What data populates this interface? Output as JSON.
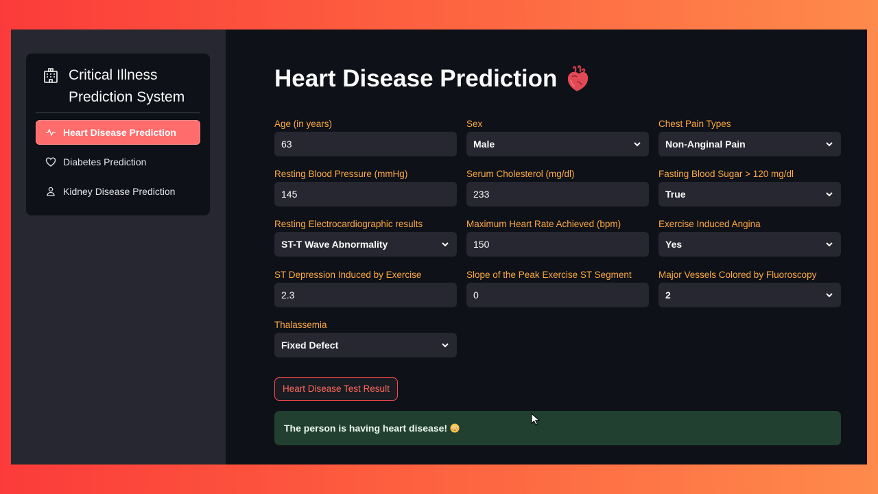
{
  "sidebar": {
    "title": "Critical Illness Prediction System",
    "items": [
      {
        "label": "Heart Disease Prediction",
        "icon": "activity-icon",
        "active": true
      },
      {
        "label": "Diabetes Prediction",
        "icon": "heart-outline-icon",
        "active": false
      },
      {
        "label": "Kidney Disease Prediction",
        "icon": "person-icon",
        "active": false
      }
    ]
  },
  "main": {
    "title": "Heart Disease Prediction",
    "title_icon": "anatomical-heart-icon",
    "fields": {
      "age": {
        "label": "Age (in years)",
        "value": "63"
      },
      "sex": {
        "label": "Sex",
        "value": "Male"
      },
      "cp": {
        "label": "Chest Pain Types",
        "value": "Non-Anginal Pain"
      },
      "bp": {
        "label": "Resting Blood Pressure (mmHg)",
        "value": "145"
      },
      "chol": {
        "label": "Serum Cholesterol (mg/dl)",
        "value": "233"
      },
      "fbs": {
        "label": "Fasting Blood Sugar > 120 mg/dl",
        "value": "True"
      },
      "ecg": {
        "label": "Resting Electrocardiographic results",
        "value": "ST-T Wave Abnormality"
      },
      "hr": {
        "label": "Maximum Heart Rate Achieved (bpm)",
        "value": "150"
      },
      "angina": {
        "label": "Exercise Induced Angina",
        "value": "Yes"
      },
      "oldpeak": {
        "label": "ST Depression Induced by Exercise",
        "value": "2.3"
      },
      "slope": {
        "label": "Slope of the Peak Exercise ST Segment",
        "value": "0"
      },
      "vessels": {
        "label": "Major Vessels Colored by Fluoroscopy",
        "value": "2"
      },
      "thal": {
        "label": "Thalassemia",
        "value": "Fixed Defect"
      }
    },
    "button_label": "Heart Disease Test Result",
    "result_text": "The person is having heart disease!",
    "result_icon": "flushed-face-icon"
  },
  "colors": {
    "accent": "#ff6c6c",
    "label": "#ffab40",
    "background": "#0e1117",
    "sidebar": "#262730",
    "success_bg": "#21402f"
  }
}
